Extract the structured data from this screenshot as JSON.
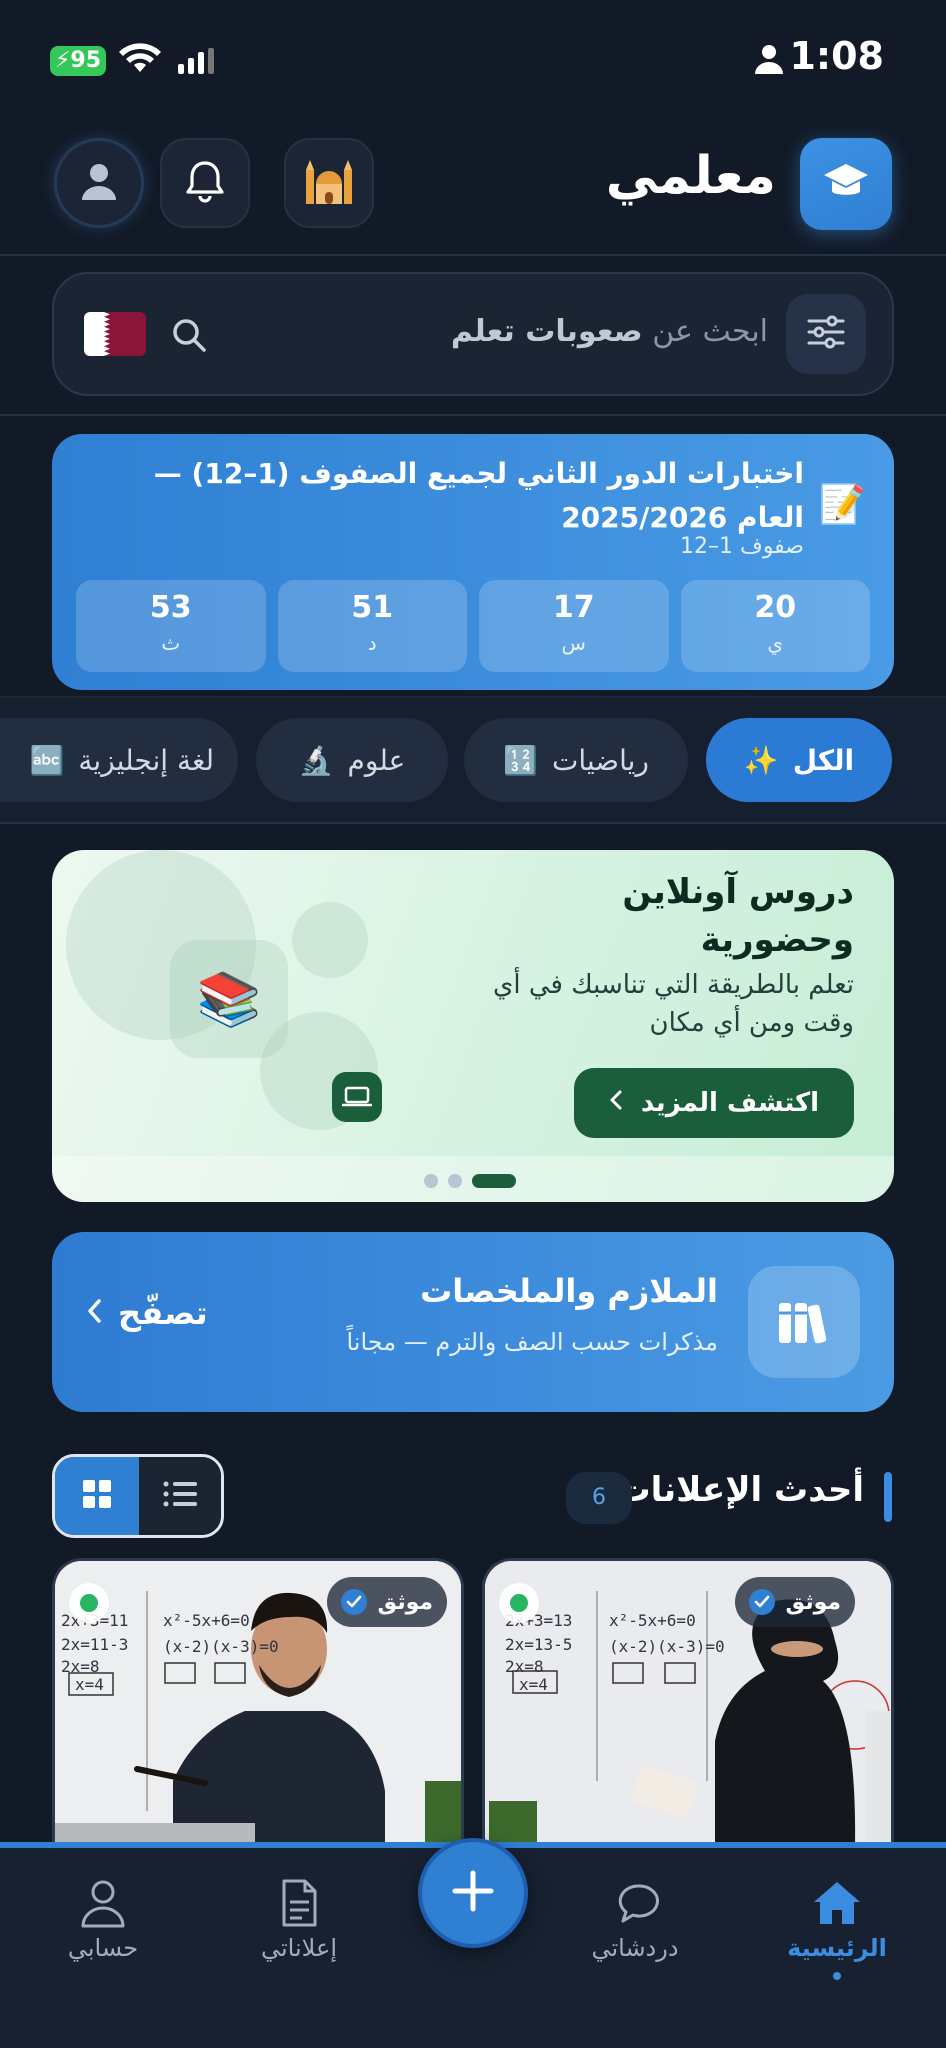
{
  "status_bar": {
    "battery": "95",
    "time": "1:08"
  },
  "header": {
    "app_name": "معلمي"
  },
  "search": {
    "placeholder_prefix": "ابحث عن",
    "placeholder_bold": "صعوبات تعلم"
  },
  "exam": {
    "title": "اختبارات الدور الثاني لجميع الصفوف (1–12) — العام 2025/2026",
    "subtitle": "صفوف 1–12",
    "countdown": [
      {
        "value": "20",
        "unit": "ي"
      },
      {
        "value": "17",
        "unit": "س"
      },
      {
        "value": "51",
        "unit": "د"
      },
      {
        "value": "53",
        "unit": "ث"
      }
    ]
  },
  "categories": [
    {
      "label": "الكل",
      "icon": "✨",
      "active": true
    },
    {
      "label": "رياضيات",
      "icon": "🔢",
      "active": false
    },
    {
      "label": "علوم",
      "icon": "🔬",
      "active": false
    },
    {
      "label": "لغة إنجليزية",
      "icon": "🔤",
      "active": false
    }
  ],
  "promo": {
    "title": "دروس آونلاين وحضورية",
    "description": "تعلم بالطريقة التي تناسبك في أي وقت ومن أي مكان",
    "button": "اكتشف المزيد",
    "slide_count": 3,
    "active_slide": 2
  },
  "notes": {
    "title": "الملازم والملخصات",
    "subtitle": "مذكرات حسب الصف والترم — مجاناً",
    "link": "تصفّح"
  },
  "ads_section": {
    "title": "أحدث الإعلانات",
    "count": "6"
  },
  "ads": [
    {
      "badge": "موثق",
      "online": true
    },
    {
      "badge": "موثق",
      "online": true
    }
  ],
  "bottom_nav": {
    "home": "الرئيسية",
    "chats": "دردشاتي",
    "my_ads": "إعلاناتي",
    "account": "حسابي"
  },
  "colors": {
    "background": "#121a27",
    "accent": "#2f7fd3",
    "promo_green": "#1b5e3b",
    "online": "#28b463"
  }
}
